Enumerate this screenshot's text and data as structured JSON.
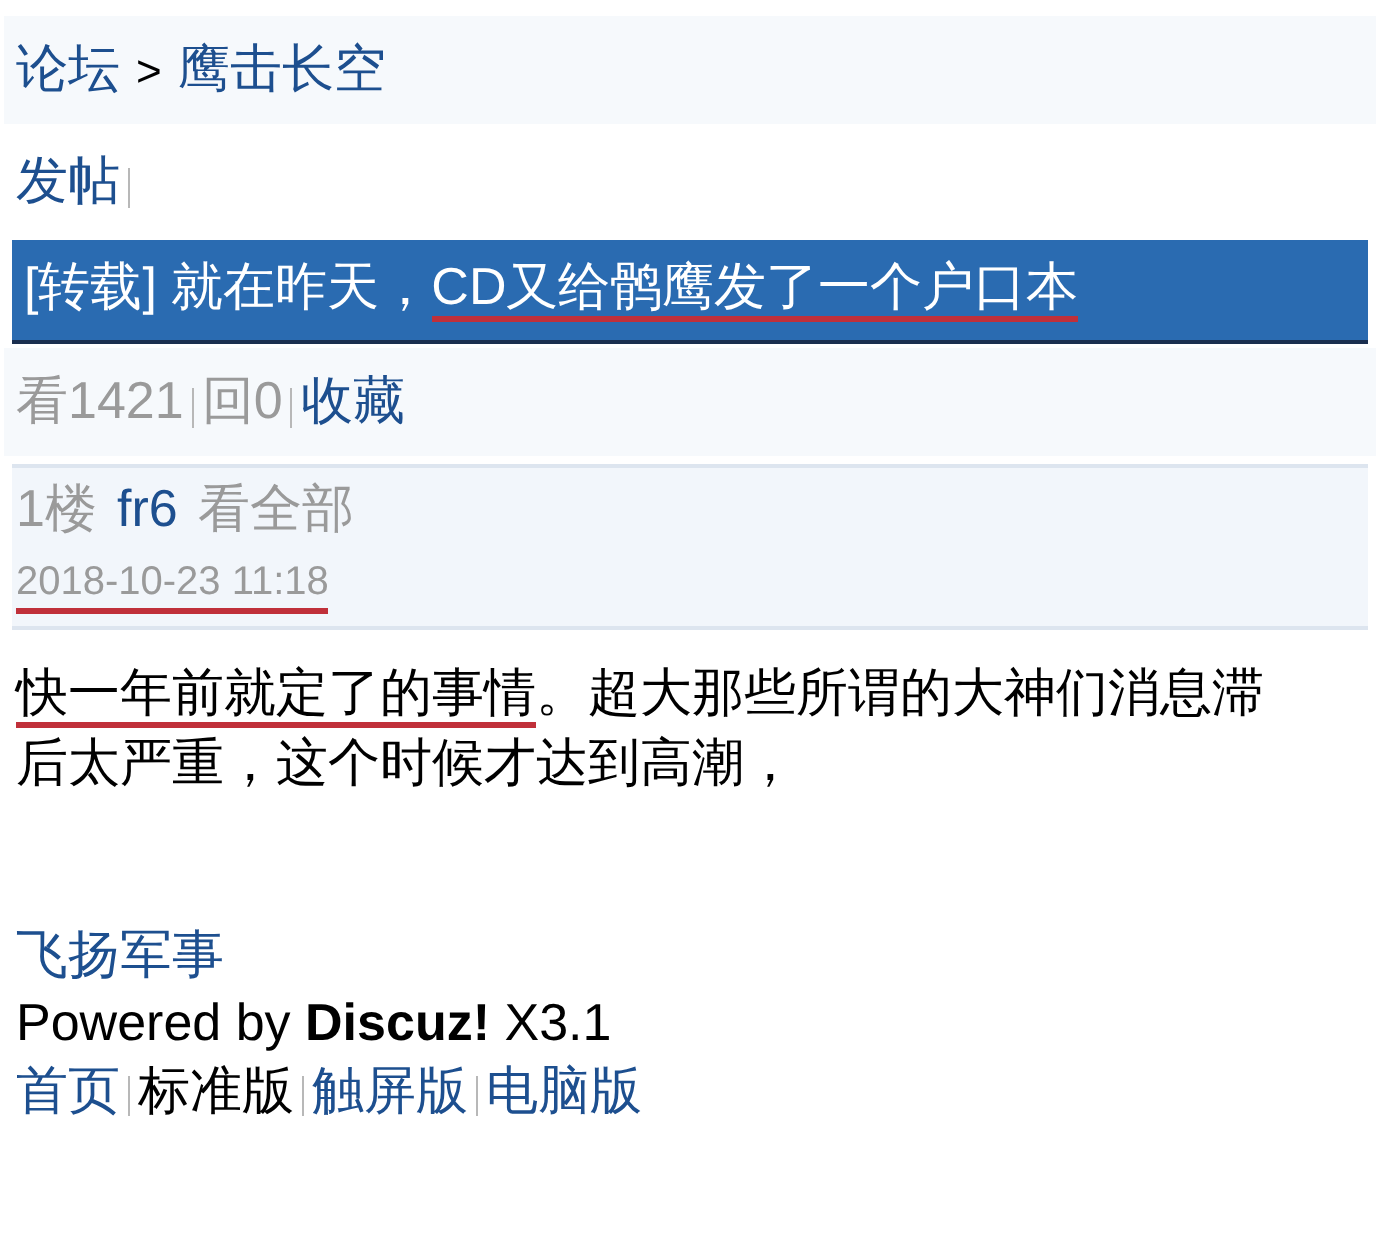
{
  "breadcrumb": {
    "root": "论坛",
    "separator": ">",
    "forum": "鹰击长空"
  },
  "actions": [
    {
      "label": "发帖"
    }
  ],
  "title": [
    {
      "text": "[转载] 就在昨天，",
      "underlined": false
    },
    {
      "text": "CD又给鹘鹰发了一个户口本",
      "underlined": true
    }
  ],
  "stats": {
    "views": "看1421",
    "replies": "回0",
    "favorite": "收藏"
  },
  "post": {
    "floor": "1楼",
    "author": "fr6",
    "view_all": "看全部",
    "time": "2018-10-23 11:18",
    "time_underlined": true,
    "body": [
      {
        "text": "快一年前就定了的事情",
        "underlined": true
      },
      {
        "text": "。超大那些所谓的大神们消息滞后太严重，这个时候才达到高潮，",
        "underlined": false
      }
    ]
  },
  "footer": {
    "site": "飞扬军事",
    "powered": "Powered by **Discuz!** X3.1",
    "links": [
      {
        "label": "首页",
        "selected": false
      },
      {
        "label": "标准版",
        "selected": true
      },
      {
        "label": "触屏版",
        "selected": false
      },
      {
        "label": "电脑版",
        "selected": false
      }
    ]
  }
}
